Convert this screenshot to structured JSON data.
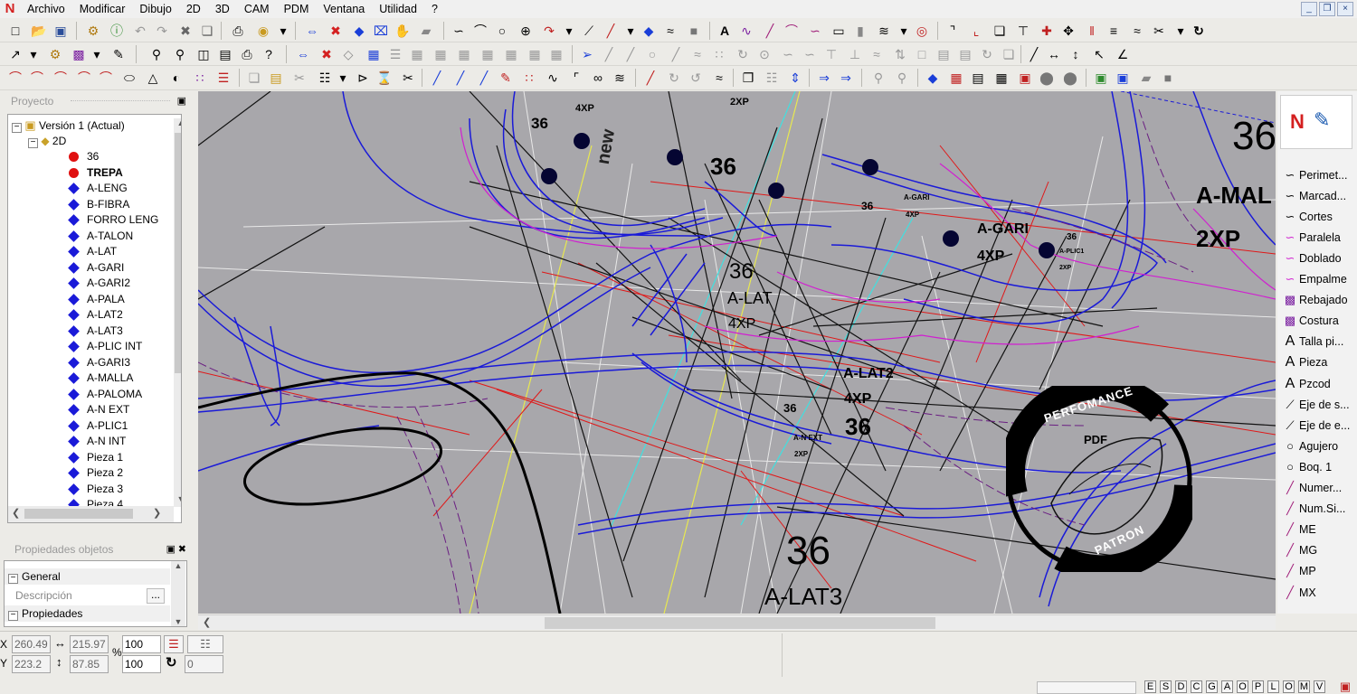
{
  "menu": [
    "Archivo",
    "Modificar",
    "Dibujo",
    "2D",
    "3D",
    "CAM",
    "PDM",
    "Ventana",
    "Utilidad",
    "?"
  ],
  "window_buttons": [
    "_",
    "❐",
    "×"
  ],
  "project_panel": {
    "title": "Proyecto",
    "version": "Versión 1 (Actual)",
    "folder": "2D",
    "items": [
      "36",
      "TREPA",
      "A-LENG",
      "B-FIBRA",
      "FORRO LENG",
      "A-TALON",
      "A-LAT",
      "A-GARI",
      "A-GARI2",
      "A-PALA",
      "A-LAT2",
      "A-LAT3",
      "A-PLIC INT",
      "A-GARI3",
      "A-MALLA",
      "A-PALOMA",
      "A-N EXT",
      "A-PLIC1",
      "A-N INT",
      "Pieza 1",
      "Pieza 2",
      "Pieza 3",
      "Pieza 4"
    ]
  },
  "props_panel": {
    "title": "Propiedades objetos",
    "general": "General",
    "descripcion": "Descripción",
    "propiedades": "Propiedades",
    "ellipsis": "..."
  },
  "right_panel": {
    "items": [
      "Perimet...",
      "Marcad...",
      "Cortes",
      "Paralela",
      "Doblado",
      "Empalme",
      "Rebajado",
      "Costura",
      "Talla pi...",
      "Pieza",
      "Pzcod",
      "Eje de s...",
      "Eje de e...",
      "Agujero",
      "Boq. 1",
      "Numer...",
      "Num.Si...",
      "ME",
      "MG",
      "MP",
      "MX"
    ]
  },
  "canvas": {
    "labels": {
      "l36a": "36",
      "l4xp_a": "4XP",
      "l2xp_a": "2XP",
      "l36b": "36",
      "l36c": "36",
      "lagari_s": "A-GARI",
      "l4xp_s": "4XP",
      "l36d": "36",
      "lagari": "A-GARI",
      "l4xp_b": "4XP",
      "l36e": "36",
      "laplic": "A-PLIC1",
      "l2xp_b": "2XP",
      "lamal": "A-MAL",
      "l2xp_c": "2XP",
      "l36big": "36",
      "l36f": "36",
      "lalat": "A-LAT",
      "l4xp_c": "4XP",
      "lalat2": "A-LAT2",
      "l4xp_d": "4XP",
      "l36g": "36",
      "l36h": "36",
      "lanext": "A-N EXT",
      "l2xp_d": "2XP",
      "l36i": "36",
      "lalat3": "A-LAT3",
      "brand": "new"
    },
    "watermark": {
      "top": "PERFOMANCE",
      "mid": "PDF",
      "bottom": "PATRON"
    }
  },
  "status": {
    "x_label": "X",
    "y_label": "Y",
    "x": "260.49",
    "y": "223.2",
    "dx": "215.97",
    "dy": "87.85",
    "pct": "%",
    "scale1": "100",
    "scale2": "100",
    "angle": "0",
    "modes": [
      "E",
      "S",
      "D",
      "C",
      "G",
      "A",
      "O",
      "P",
      "L",
      "O",
      "M",
      "V"
    ]
  }
}
